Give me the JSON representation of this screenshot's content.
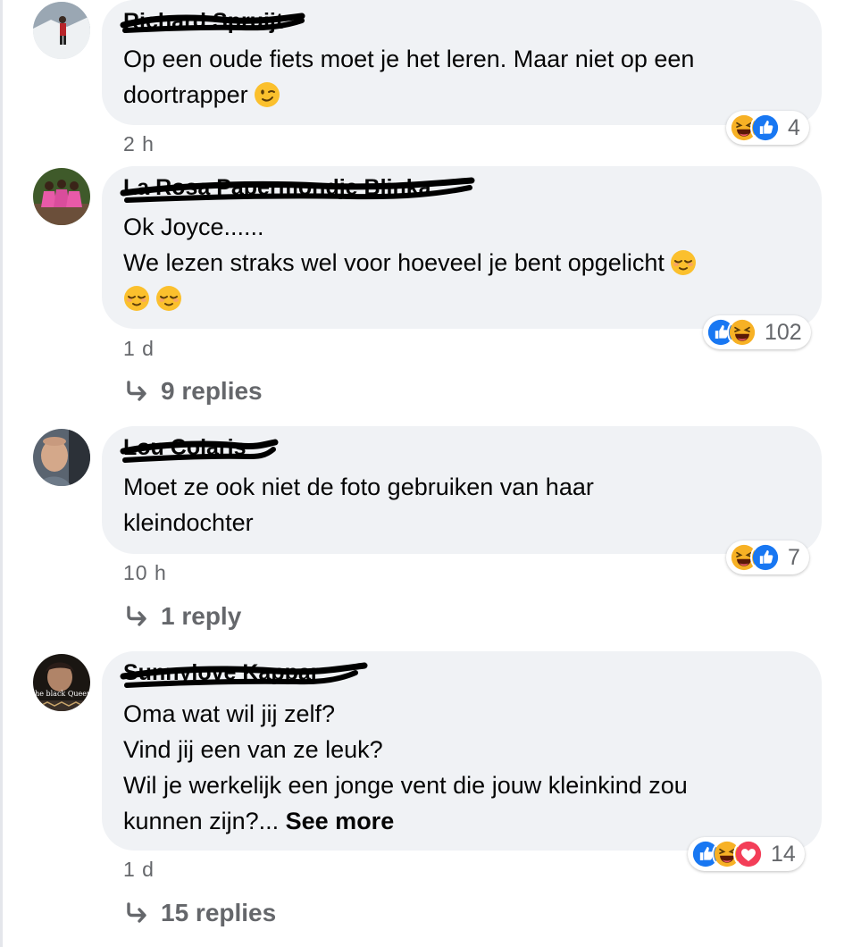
{
  "comments": [
    {
      "author": "Richard Spruijt",
      "lines": [
        "Op een oude fiets moet je het leren. Maar niet op een",
        "doortrapper"
      ],
      "trailing_emoji": [
        "winking-face"
      ],
      "reactions": [
        "haha-icon",
        "like-icon"
      ],
      "reaction_count": "4",
      "time": "2 h",
      "replies": ""
    },
    {
      "author": "La Rosa Papermondje Blinka",
      "lines": [
        "Ok Joyce......",
        "We lezen straks wel voor hoeveel je bent opgelicht",
        ""
      ],
      "trailing_emoji": [
        "relieved-face"
      ],
      "reactions": [
        "like-icon",
        "haha-icon"
      ],
      "reaction_count": "102",
      "time": "1 d",
      "replies": "9 replies"
    },
    {
      "author": "Lou Colaris",
      "lines": [
        "Moet ze ook niet de foto gebruiken van haar",
        "kleindochter"
      ],
      "reactions": [
        "haha-icon",
        "like-icon"
      ],
      "reaction_count": "7",
      "time": "10 h",
      "replies": "1 reply"
    },
    {
      "author": "Sunnylove Kappar",
      "lines": [
        "Oma wat wil jij zelf?",
        "Vind jij een van ze leuk?",
        "Wil je werkelijk een jonge vent die jouw kleinkind zou",
        "kunnen zijn?..."
      ],
      "see_more": "See more",
      "avatar_caption": "the black Queen",
      "reactions": [
        "like-icon",
        "haha-icon",
        "love-icon"
      ],
      "reaction_count": "14",
      "time": "1 d",
      "replies": "15 replies"
    }
  ],
  "colors": {
    "bubble": "#f0f2f5",
    "meta_text": "#65676b",
    "like_blue": "#1877f2",
    "haha_yellow": "#f7b125",
    "love_red": "#f33e58"
  }
}
